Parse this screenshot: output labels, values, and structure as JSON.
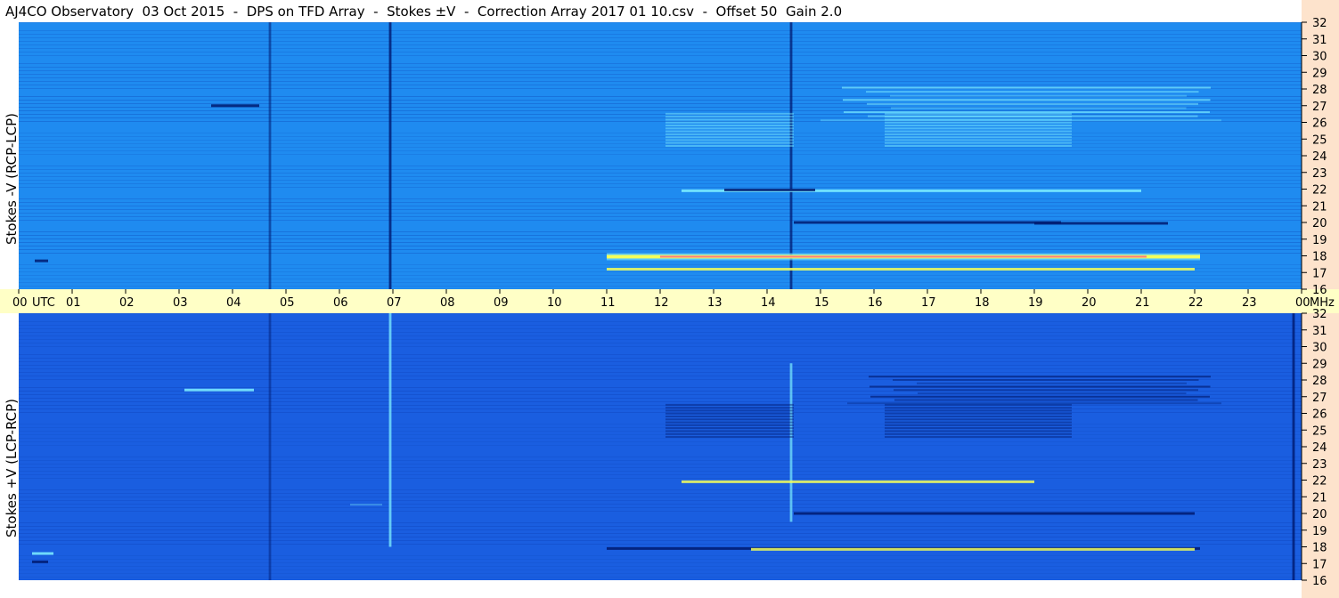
{
  "title": "AJ4CO Observatory  03 Oct 2015  -  DPS on TFD Array  -  Stokes ±V  -  Correction Array 2017 01 10.csv  -  Offset 50  Gain 2.0",
  "colors": {
    "background_top": "#1f8bf0",
    "background_bottom": "#1a5ee0",
    "time_strip": "#ffffc6",
    "freq_strip": "#fde3cc",
    "burst_cyan": "#7ff0ff",
    "burst_yellow": "#f4ff5a",
    "burst_red": "#ff5a8a",
    "dark_line": "#001a70"
  },
  "chart_data": [
    {
      "type": "heatmap",
      "name": "top-panel",
      "ylabel": "Stokes -V (RCP-LCP)",
      "x_unit": "UTC",
      "x_range": [
        0,
        24
      ],
      "y_unit": "MHz",
      "y_range": [
        16,
        32
      ],
      "features": [
        {
          "kind": "vline",
          "x": 4.7,
          "y0": 16,
          "y1": 32,
          "strength": 0.6,
          "color": "dark"
        },
        {
          "kind": "vline",
          "x": 6.95,
          "y0": 16,
          "y1": 32,
          "strength": 1.0,
          "color": "dark"
        },
        {
          "kind": "vline",
          "x": 14.45,
          "y0": 16,
          "y1": 32,
          "strength": 0.9,
          "color": "dark"
        },
        {
          "kind": "band",
          "x0": 11.0,
          "x1": 22.1,
          "y": 17.95,
          "color": "hot"
        },
        {
          "kind": "band",
          "x0": 11.0,
          "x1": 22.0,
          "y": 17.2,
          "color": "yellow"
        },
        {
          "kind": "band",
          "x0": 12.4,
          "x1": 21.0,
          "y": 21.9,
          "color": "cyan"
        },
        {
          "kind": "band",
          "x0": 13.2,
          "x1": 14.9,
          "y": 21.95,
          "color": "dark"
        },
        {
          "kind": "band",
          "x0": 14.5,
          "x1": 19.5,
          "y": 20.0,
          "color": "dark"
        },
        {
          "kind": "band",
          "x0": 19.0,
          "x1": 21.5,
          "y": 19.95,
          "color": "dark"
        },
        {
          "kind": "band",
          "x0": 3.6,
          "x1": 4.5,
          "y": 27.0,
          "color": "dark"
        },
        {
          "kind": "band",
          "x0": 0.3,
          "x1": 0.55,
          "y": 17.7,
          "color": "dark"
        },
        {
          "kind": "patch",
          "x0": 15.0,
          "x1": 22.5,
          "y0": 26.0,
          "y1": 28.2,
          "color": "cyan"
        },
        {
          "kind": "stripes",
          "x0": 12.1,
          "x1": 14.5,
          "y0": 24.5,
          "y1": 26.6,
          "color": "cyan"
        },
        {
          "kind": "stripes",
          "x0": 16.2,
          "x1": 19.7,
          "y0": 24.5,
          "y1": 26.6,
          "color": "cyan"
        }
      ]
    },
    {
      "type": "heatmap",
      "name": "bottom-panel",
      "ylabel": "Stokes +V (LCP-RCP)",
      "x_unit": "UTC",
      "x_range": [
        0,
        24
      ],
      "y_unit": "MHz",
      "y_range": [
        16,
        32
      ],
      "features": [
        {
          "kind": "vline",
          "x": 4.7,
          "y0": 16,
          "y1": 32,
          "strength": 0.5,
          "color": "dark"
        },
        {
          "kind": "vline",
          "x": 6.95,
          "y0": 18,
          "y1": 32,
          "strength": 0.9,
          "color": "cyan"
        },
        {
          "kind": "vline",
          "x": 14.45,
          "y0": 19.5,
          "y1": 29,
          "strength": 0.8,
          "color": "cyan"
        },
        {
          "kind": "vline",
          "x": 23.85,
          "y0": 16,
          "y1": 32,
          "strength": 1.0,
          "color": "dark"
        },
        {
          "kind": "patch",
          "x0": 6.2,
          "x1": 6.8,
          "y0": 20.0,
          "y1": 29.5,
          "color": "cyan"
        },
        {
          "kind": "band",
          "x0": 11.0,
          "x1": 22.1,
          "y": 17.9,
          "color": "dark"
        },
        {
          "kind": "band",
          "x0": 13.7,
          "x1": 22.0,
          "y": 17.85,
          "color": "yellow"
        },
        {
          "kind": "band",
          "x0": 12.4,
          "x1": 19.0,
          "y": 21.9,
          "color": "yellow"
        },
        {
          "kind": "band",
          "x0": 14.5,
          "x1": 22.0,
          "y": 20.0,
          "color": "dark"
        },
        {
          "kind": "band",
          "x0": 0.25,
          "x1": 0.55,
          "y": 17.1,
          "color": "dark"
        },
        {
          "kind": "band",
          "x0": 0.25,
          "x1": 0.65,
          "y": 17.6,
          "color": "cyan"
        },
        {
          "kind": "band",
          "x0": 3.1,
          "x1": 4.4,
          "y": 27.4,
          "color": "cyan"
        },
        {
          "kind": "patch",
          "x0": 15.5,
          "x1": 22.5,
          "y0": 26.5,
          "y1": 28.3,
          "color": "dark"
        },
        {
          "kind": "stripes",
          "x0": 12.1,
          "x1": 14.5,
          "y0": 24.5,
          "y1": 26.6,
          "color": "dark"
        },
        {
          "kind": "stripes",
          "x0": 16.2,
          "x1": 19.7,
          "y0": 24.5,
          "y1": 26.6,
          "color": "dark"
        }
      ]
    }
  ],
  "y_ticks": [
    "16",
    "17",
    "18",
    "19",
    "20",
    "21",
    "22",
    "23",
    "24",
    "25",
    "26",
    "27",
    "28",
    "29",
    "30",
    "31",
    "32"
  ],
  "y_unit_label": "MHz",
  "x_ticks": [
    "00",
    "01",
    "02",
    "03",
    "04",
    "05",
    "06",
    "07",
    "08",
    "09",
    "10",
    "11",
    "12",
    "13",
    "14",
    "15",
    "16",
    "17",
    "18",
    "19",
    "20",
    "21",
    "22",
    "23",
    "00"
  ],
  "x_unit_label": "UTC"
}
